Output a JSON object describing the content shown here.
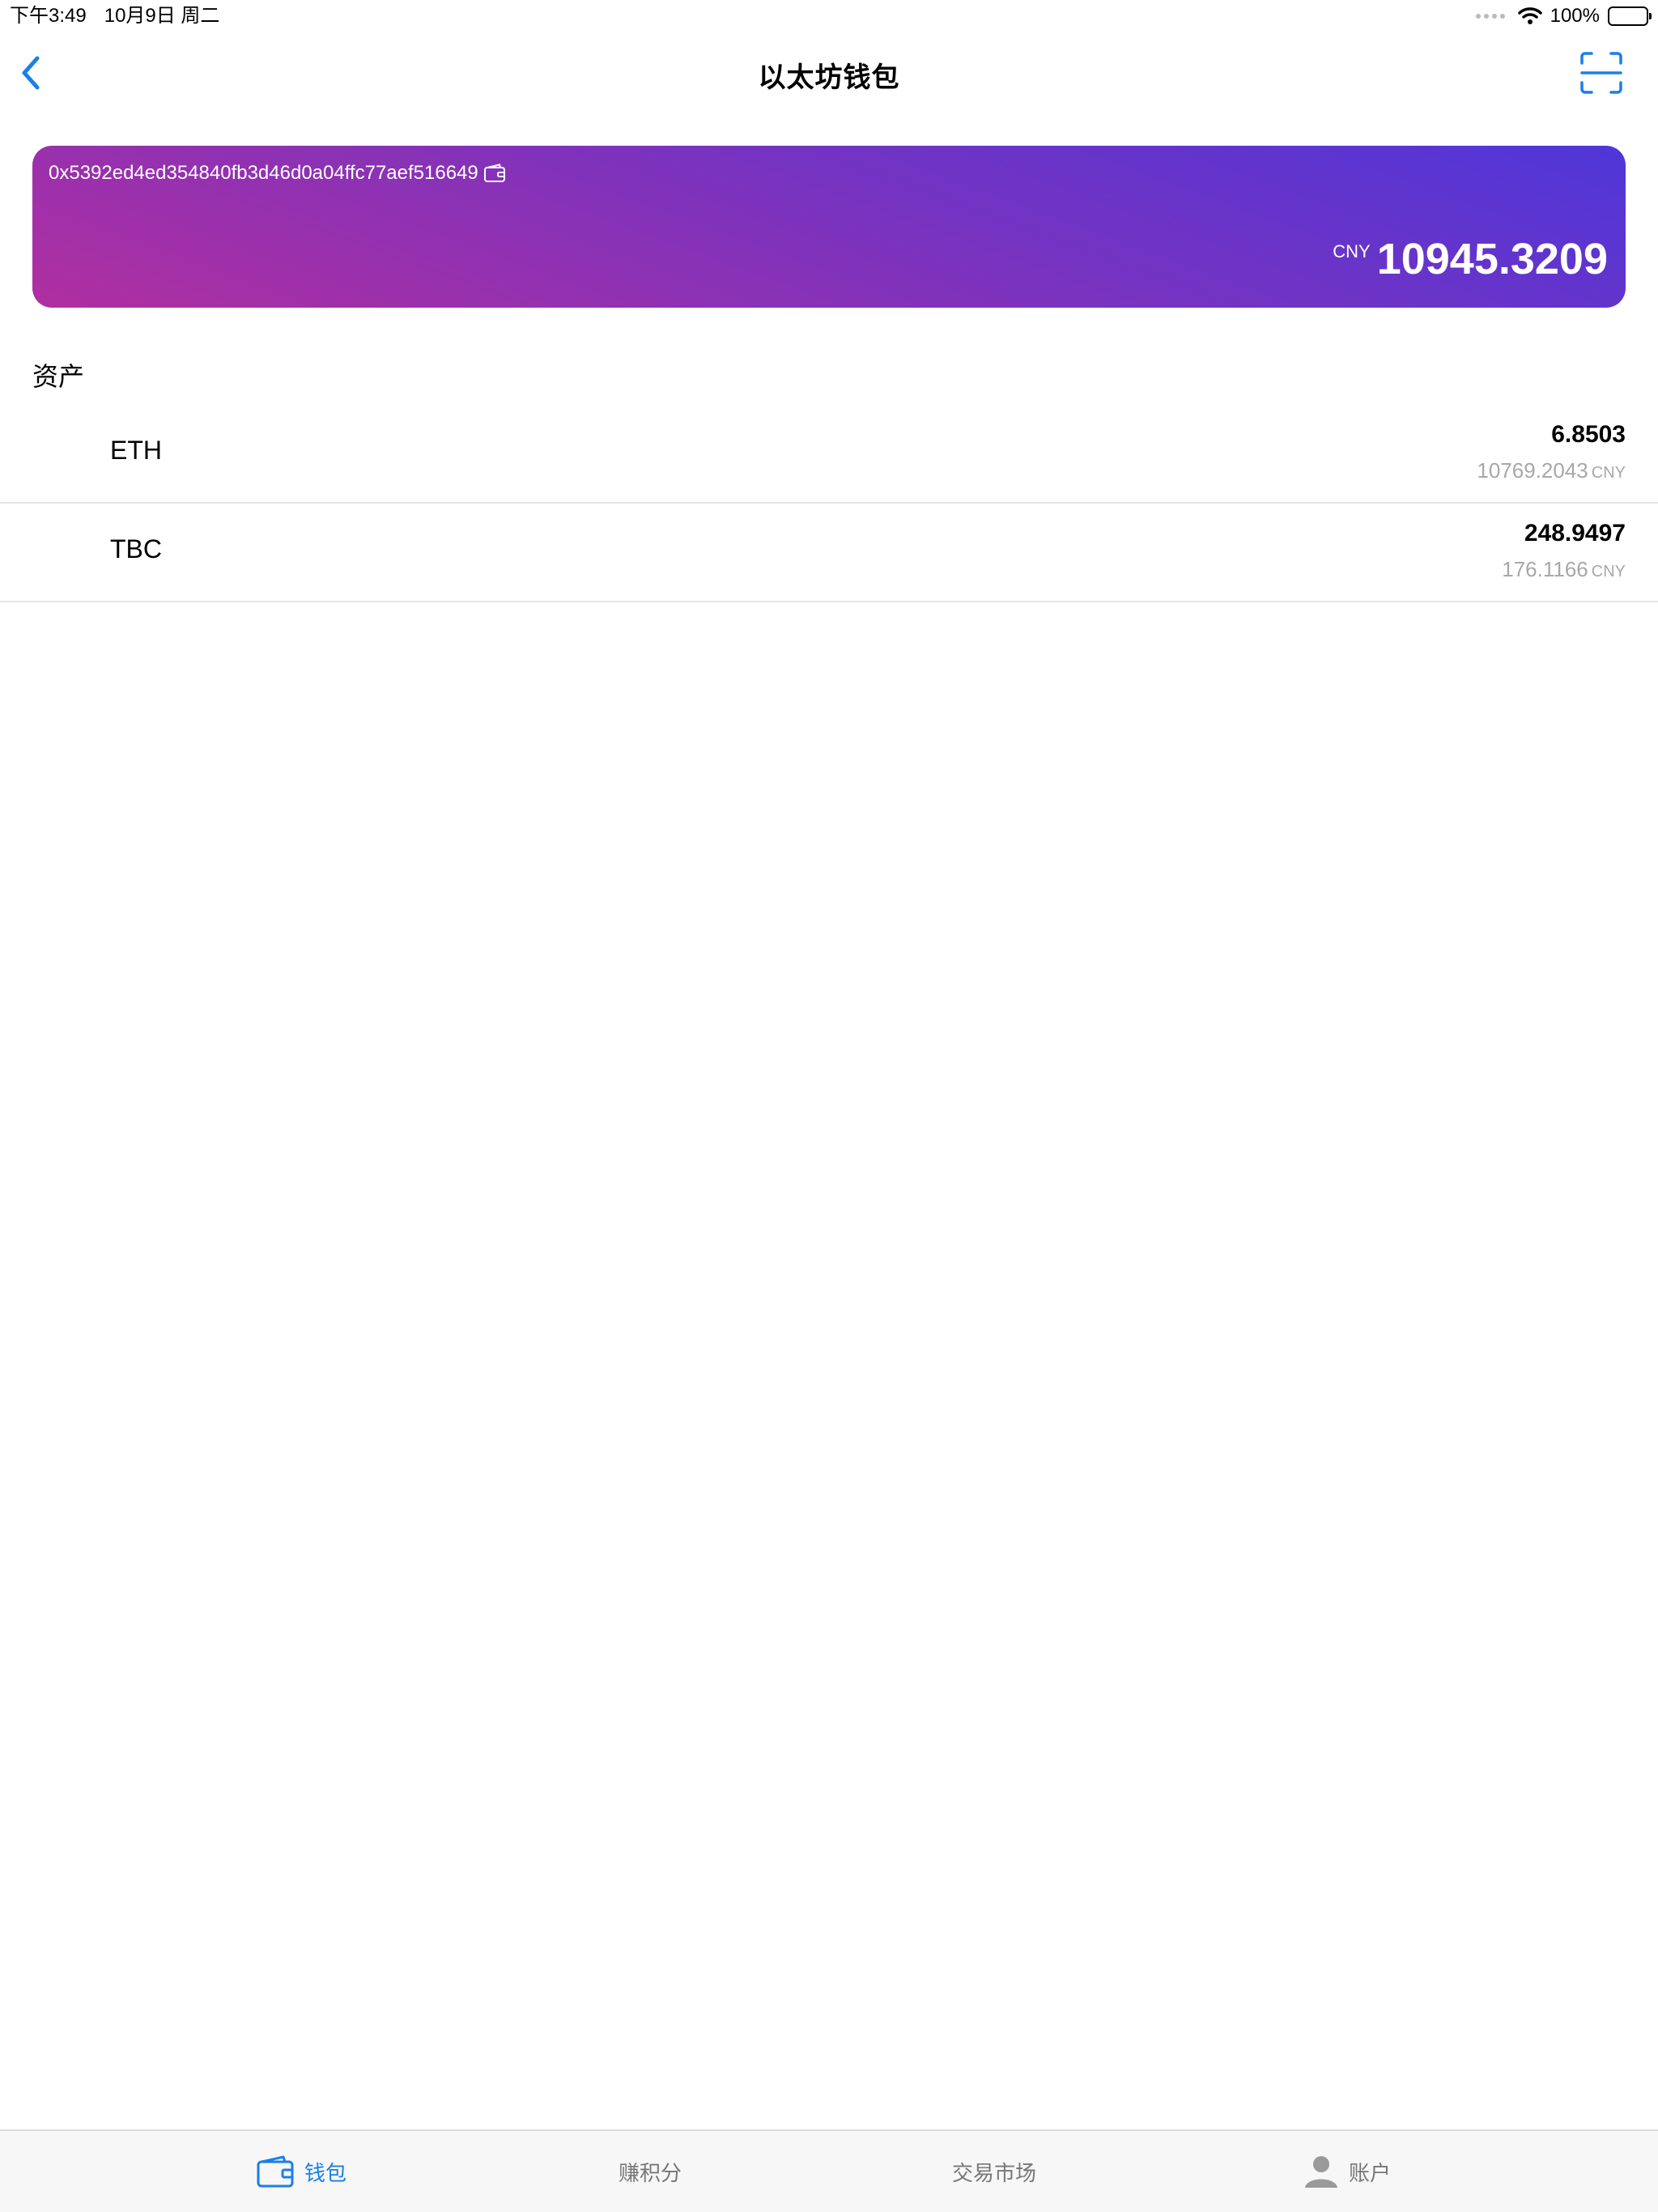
{
  "status_bar": {
    "time": "下午3:49",
    "date": "10月9日 周二",
    "battery": "100%"
  },
  "nav": {
    "title": "以太坊钱包"
  },
  "wallet": {
    "address": "0x5392ed4ed354840fb3d46d0a04ffc77aef516649",
    "currency": "CNY",
    "balance": "10945.3209"
  },
  "assets": {
    "section_title": "资产",
    "items": [
      {
        "symbol": "ETH",
        "amount": "6.8503",
        "value": "10769.2043",
        "unit": "CNY"
      },
      {
        "symbol": "TBC",
        "amount": "248.9497",
        "value": "176.1166",
        "unit": "CNY"
      }
    ]
  },
  "tabs": [
    {
      "label": "钱包",
      "icon": "wallet-icon",
      "active": true
    },
    {
      "label": "赚积分",
      "icon": "none",
      "active": false
    },
    {
      "label": "交易市场",
      "icon": "none",
      "active": false
    },
    {
      "label": "账户",
      "icon": "person-icon",
      "active": false
    }
  ],
  "colors": {
    "accent": "#1a7fe8",
    "card_gradient_start": "#4f36d8",
    "card_gradient_end": "#b02fa0"
  }
}
